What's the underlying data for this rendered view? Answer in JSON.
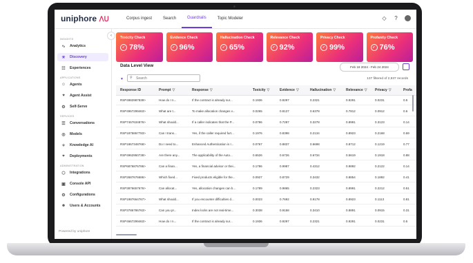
{
  "app": {
    "brand": "uniphore",
    "brand_mark": "ᐱᑌ"
  },
  "topnav": {
    "tabs": [
      "Corpus ingest",
      "Search",
      "Guardrails",
      "Topic Modeler"
    ],
    "active": "Guardrails"
  },
  "topicons": [
    "bell-icon",
    "help-icon",
    "avatar"
  ],
  "sidebar": {
    "sections": [
      {
        "label": "INSIGHTS",
        "items": [
          {
            "label": "Analytics",
            "icon": "analytics-icon"
          },
          {
            "label": "Discovery",
            "icon": "bulb-icon",
            "active": true
          },
          {
            "label": "Experiences",
            "icon": "experiences-icon"
          }
        ]
      },
      {
        "label": "APPLICATIONS",
        "items": [
          {
            "label": "Agents",
            "icon": "agents-icon"
          },
          {
            "label": "Agent Assist",
            "icon": "agent-assist-icon"
          },
          {
            "label": "Self-Serve",
            "icon": "self-serve-icon"
          }
        ]
      },
      {
        "label": "SERVICES",
        "items": [
          {
            "label": "Conversations",
            "icon": "conversations-icon"
          },
          {
            "label": "Models",
            "icon": "models-icon"
          },
          {
            "label": "Knowledge AI",
            "icon": "knowledge-icon"
          },
          {
            "label": "Deployments",
            "icon": "deployments-icon"
          }
        ]
      },
      {
        "label": "ADMINISTRATION",
        "items": [
          {
            "label": "Integrations",
            "icon": "integrations-icon"
          },
          {
            "label": "Console API",
            "icon": "console-icon"
          },
          {
            "label": "Configurations",
            "icon": "config-icon"
          },
          {
            "label": "Users & Accounts",
            "icon": "users-icon"
          }
        ]
      }
    ],
    "footer": "Powered by uniphore"
  },
  "cards": [
    {
      "title": "Toxicity Check",
      "value": "78%"
    },
    {
      "title": "Evidence Check",
      "value": "96%"
    },
    {
      "title": "Hallucination Check",
      "value": "65%"
    },
    {
      "title": "Relevance Check",
      "value": "92%"
    },
    {
      "title": "Privacy Check",
      "value": "99%"
    },
    {
      "title": "Profanity Check",
      "value": "76%"
    }
  ],
  "data_view": {
    "title": "Data Level View",
    "date_range": "Feb 18 2024 - Feb 24 2024",
    "search_placeholder": "Search",
    "filtered_text": "137 filtered of 2,937 records"
  },
  "table": {
    "columns": [
      "Response ID",
      "Prompt",
      "Response",
      "Toxicity",
      "Evidence",
      "Hallucination",
      "Relevance",
      "Privacy",
      "Profa"
    ],
    "rows": [
      [
        "RSP4982987839>",
        "How do I n...",
        "If the contract is already sur...",
        "0.1936",
        "0.9297",
        "0.2321",
        "0.9291",
        "0.0231",
        "0.5"
      ],
      [
        "RSP4967299463>",
        "What are t...",
        "To make allocation changes v...",
        "0.0265",
        "0.8127",
        "0.6378",
        "0.7812",
        "0.0912",
        "0.6"
      ],
      [
        "RSP7467634876>",
        "What should...",
        "If a caller indicates that the P...",
        "0.0786",
        "0.7287",
        "0.3278",
        "0.8991",
        "0.3123",
        "0.14"
      ],
      [
        "RSP1875867783>",
        "Can I trans...",
        "Yes, if the caller required furt...",
        "0.1976",
        "0.8398",
        "0.2134",
        "0.8923",
        "0.2168",
        "0.69"
      ],
      [
        "RSP1867348768>",
        "Do I need to...",
        "Enhanced Authentication is r...",
        "0.0767",
        "0.8837",
        "0.6698",
        "0.8712",
        "0.1219",
        "0.77"
      ],
      [
        "RSP4962950738>",
        "Are there any...",
        "The applicability of the Auto...",
        "0.6526",
        "0.6726",
        "0.6734",
        "0.5619",
        "0.1918",
        "0.88"
      ],
      [
        "RSP6876876786>",
        "Can a finan...",
        "Yes, a financial advisor or thei...",
        "0.1786",
        "0.9987",
        "0.4312",
        "0.9892",
        "0.2122",
        "0.14"
      ],
      [
        "RSP2687676686>",
        "Which fixed...",
        "Fixed products eligible for the...",
        "0.0927",
        "0.8729",
        "0.3432",
        "0.8854",
        "0.1892",
        "0.41"
      ],
      [
        "RSP3876657676>",
        "Can allocat...",
        "Yes, allocation changes can b...",
        "0.1789",
        "0.9865",
        "0.2323",
        "0.8991",
        "0.2212",
        "0.51"
      ],
      [
        "RSP1987664767>",
        "What should...",
        "If you encounter difficulties d...",
        "0.0023",
        "0.7692",
        "0.9178",
        "0.8923",
        "0.1113",
        "0.81"
      ],
      [
        "RSP3786786763>",
        "Can you pr...",
        "Index locks are not real-time...",
        "0.3038",
        "0.9158",
        "0.3410",
        "0.8891",
        "0.0915",
        "0.31"
      ],
      [
        "RSP4667299463>",
        "How do I n...",
        "If the contract is already sur...",
        "0.1936",
        "0.9297",
        "0.2321",
        "0.9291",
        "0.0231",
        "0.5"
      ]
    ]
  },
  "colors": {
    "accent": "#6b3fd4",
    "card_gradient_start": "#ff7a3c",
    "card_gradient_end": "#b91f9a"
  }
}
